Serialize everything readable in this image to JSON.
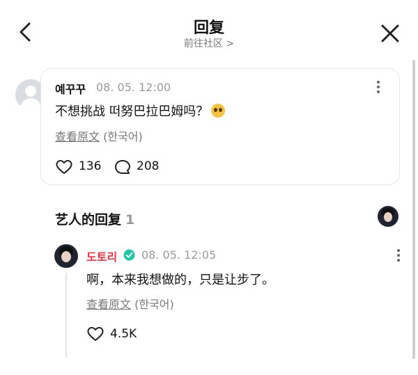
{
  "header": {
    "title": "回复",
    "subtitle": "前往社区 >"
  },
  "comment": {
    "author": "예꾸꾸",
    "timestamp": "08. 05. 12:00",
    "text": "不想挑战 떠努巴拉巴姆吗？",
    "emoji": "pleading-face",
    "translate_link": "查看原文",
    "translate_lang": "(한국어)",
    "likes": "136",
    "replies": "208"
  },
  "section": {
    "title": "艺人的回复",
    "count": "1"
  },
  "artist_reply": {
    "author": "도토리",
    "author_color": "#ff2b3a",
    "timestamp": "08. 05. 12:05",
    "text": "啊，本来我想做的，只是让步了。",
    "translate_link": "查看原文",
    "translate_lang": "(한국어)",
    "likes": "4.5K"
  },
  "colors": {
    "verified": "#1fc6a8",
    "accent": "#ff2b3a"
  },
  "icons": [
    "back-icon",
    "close-icon",
    "more-icon",
    "heart-icon",
    "reply-bubble-icon",
    "verified-badge-icon"
  ]
}
